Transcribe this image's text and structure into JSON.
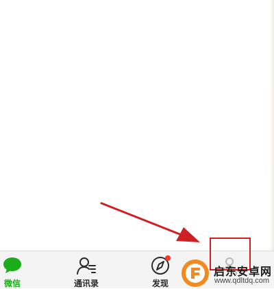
{
  "tab_bar": {
    "items": [
      {
        "label": "微信",
        "active": true
      },
      {
        "label": "通讯录",
        "active": false
      },
      {
        "label": "发现",
        "active": false,
        "badge_dot": true
      },
      {
        "label": "",
        "active": false
      }
    ]
  },
  "colors": {
    "active_green": "#1aad19",
    "annotation_red": "#d01f23",
    "badge_red": "#f43530",
    "tab_bar_bg": "#f4f4f4"
  },
  "watermark": {
    "title": "启东安卓网",
    "url": "www.qdltdq.com"
  }
}
